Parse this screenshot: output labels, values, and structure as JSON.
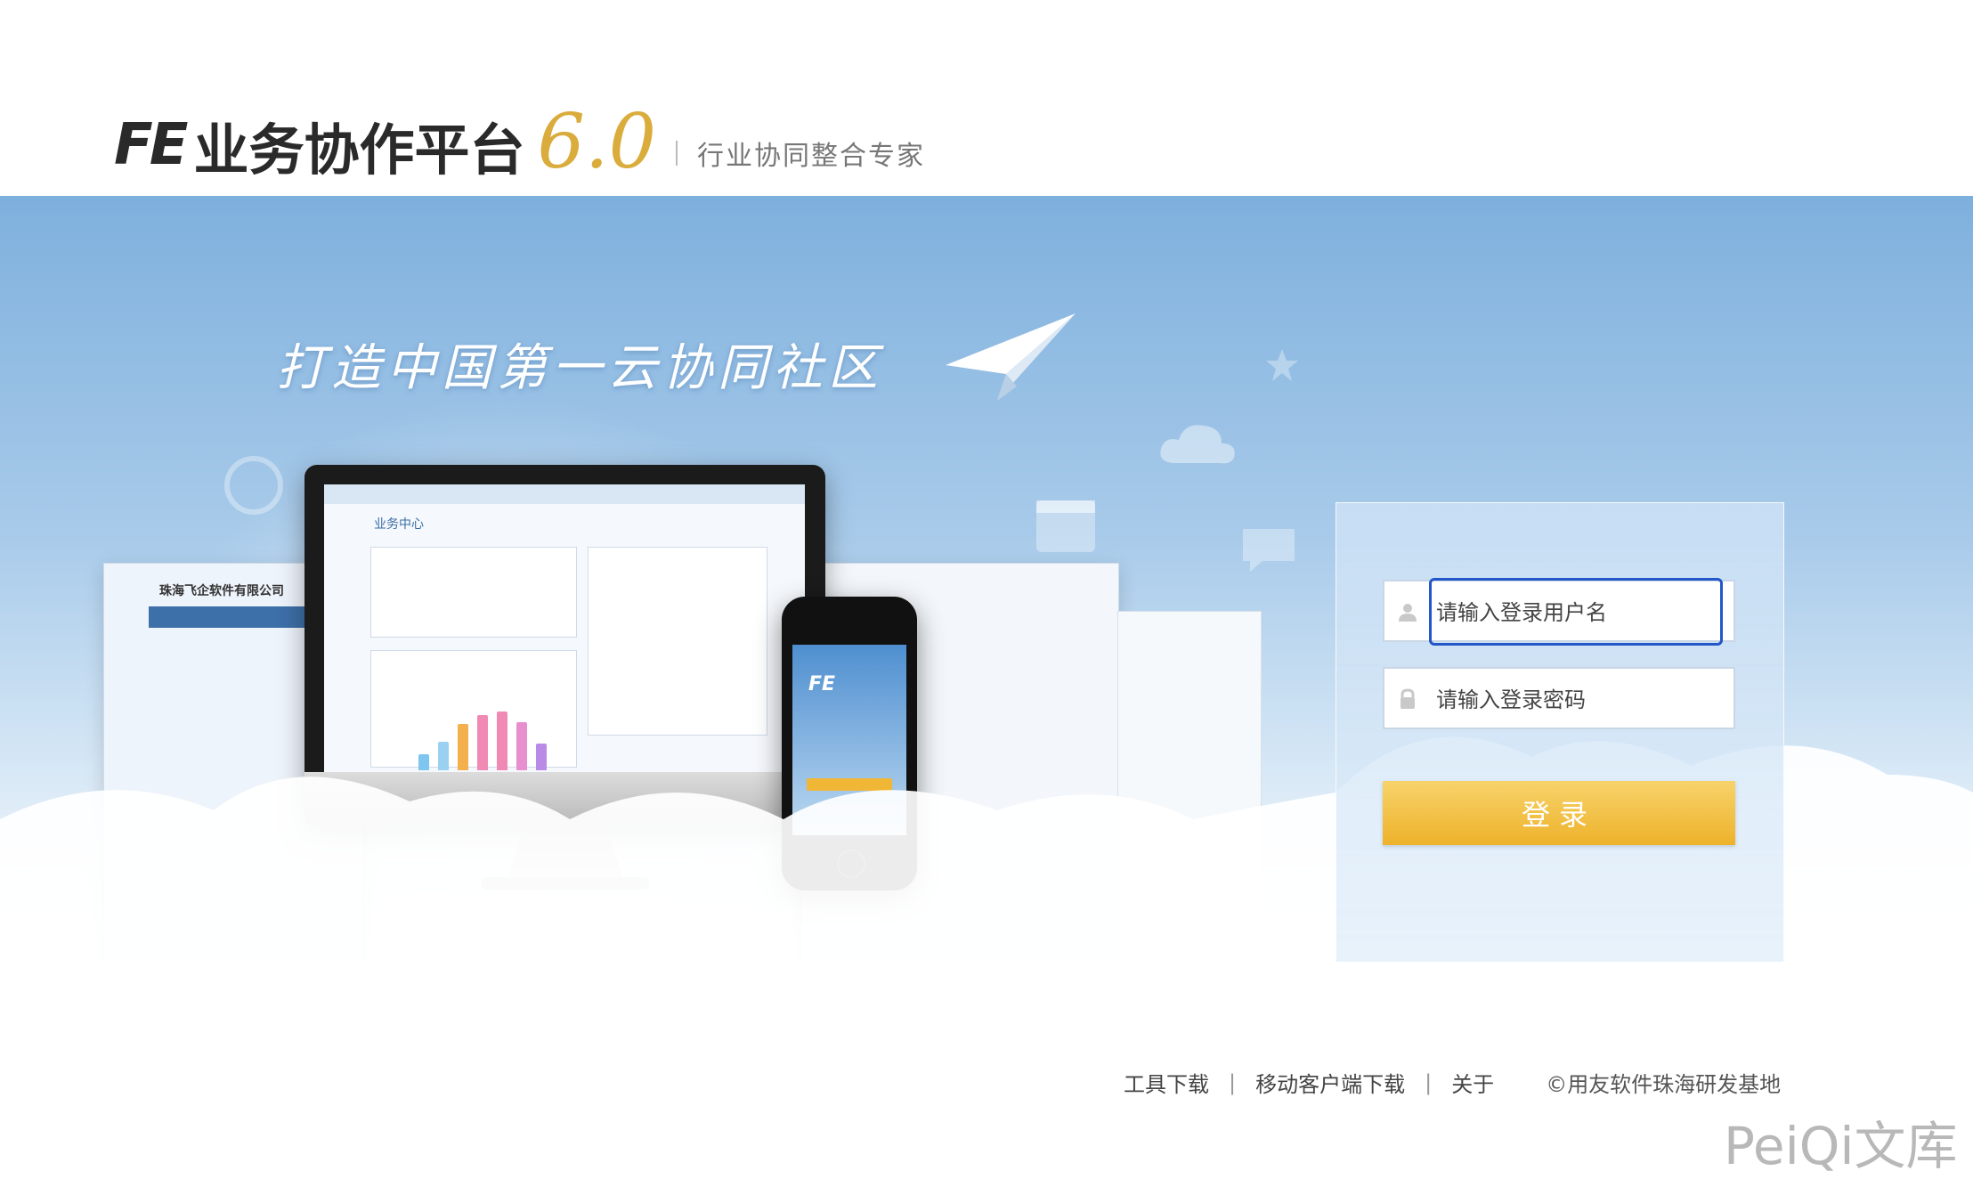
{
  "header": {
    "logo_fe": "FE",
    "logo_name": "业务协作平台",
    "logo_version": "6.0",
    "slogan": "行业协同整合专家"
  },
  "banner": {
    "handwritten_slogan": "打造中国第一云协同社区",
    "left_screen_company": "珠海飞企软件有限公司",
    "monitor_title": "业务中心"
  },
  "login": {
    "username_placeholder": "请输入登录用户名",
    "password_placeholder": "请输入登录密码",
    "submit_label": "登录",
    "accent_color": "#eeb22b",
    "focus_color": "#2256c9"
  },
  "footer": {
    "links": [
      "工具下载",
      "移动客户端下载",
      "关于"
    ],
    "copyright": "©用友软件珠海研发基地"
  },
  "watermark": "PeiQi文库"
}
